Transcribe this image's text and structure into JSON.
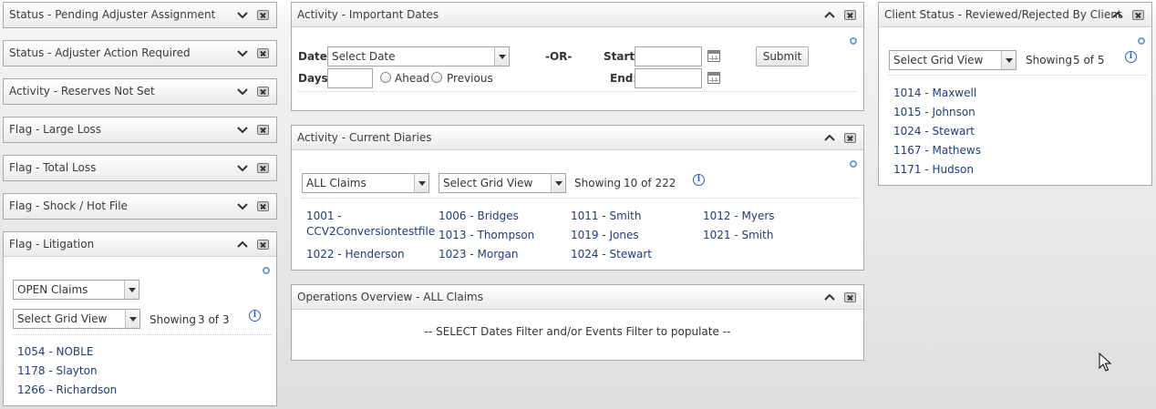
{
  "left_panels": [
    {
      "title": "Status - Pending Adjuster Assignment"
    },
    {
      "title": "Status - Adjuster Action Required"
    },
    {
      "title": "Activity - Reserves Not Set"
    },
    {
      "title": "Flag - Large Loss"
    },
    {
      "title": "Flag - Total Loss"
    },
    {
      "title": "Flag - Shock / Hot File"
    }
  ],
  "litigation": {
    "title": "Flag - Litigation",
    "claims_filter": "OPEN Claims",
    "grid_view": "Select Grid View",
    "showing_label": "Showing",
    "showing_value": "3 of 3",
    "items": [
      "1054 - NOBLE",
      "1178 - Slayton",
      "1266 - Richardson"
    ]
  },
  "important_dates": {
    "title": "Activity - Important Dates",
    "date_label": "Date:",
    "date_select": "Select Date",
    "or_label": "-OR-",
    "start_label": "Start:",
    "end_label": "End:",
    "days_label": "Days:",
    "ahead_label": "Ahead",
    "previous_label": "Previous",
    "submit_label": "Submit"
  },
  "current_diaries": {
    "title": "Activity - Current Diaries",
    "claims_filter": "ALL Claims",
    "grid_view": "Select Grid View",
    "showing_label": "Showing",
    "showing_value": "10 of 222",
    "items": [
      "1001 - CCV2Conversiontestfile",
      "1006 - Bridges",
      "1011 - Smith",
      "1012 - Myers",
      "1013 - Thompson",
      "1019 - Jones",
      "1021 - Smith",
      "1022 - Henderson",
      "1023 - Morgan",
      "1024 - Stewart"
    ]
  },
  "operations": {
    "title": "Operations Overview - ALL Claims",
    "message": "-- SELECT Dates Filter and/or Events Filter to populate --"
  },
  "client_status": {
    "title": "Client Status - Reviewed/Rejected By Client",
    "grid_view": "Select Grid View",
    "showing_label": "Showing",
    "showing_value": "5 of 5",
    "items": [
      "1014 - Maxwell",
      "1015 - Johnson",
      "1024 - Stewart",
      "1167 - Mathews",
      "1171 - Hudson"
    ]
  },
  "icons": {
    "expand": "chevron-down-icon",
    "collapse": "chevron-up-icon",
    "close": "close-icon",
    "settings": "gear-icon",
    "info": "info-icon",
    "calendar": "calendar-icon"
  }
}
